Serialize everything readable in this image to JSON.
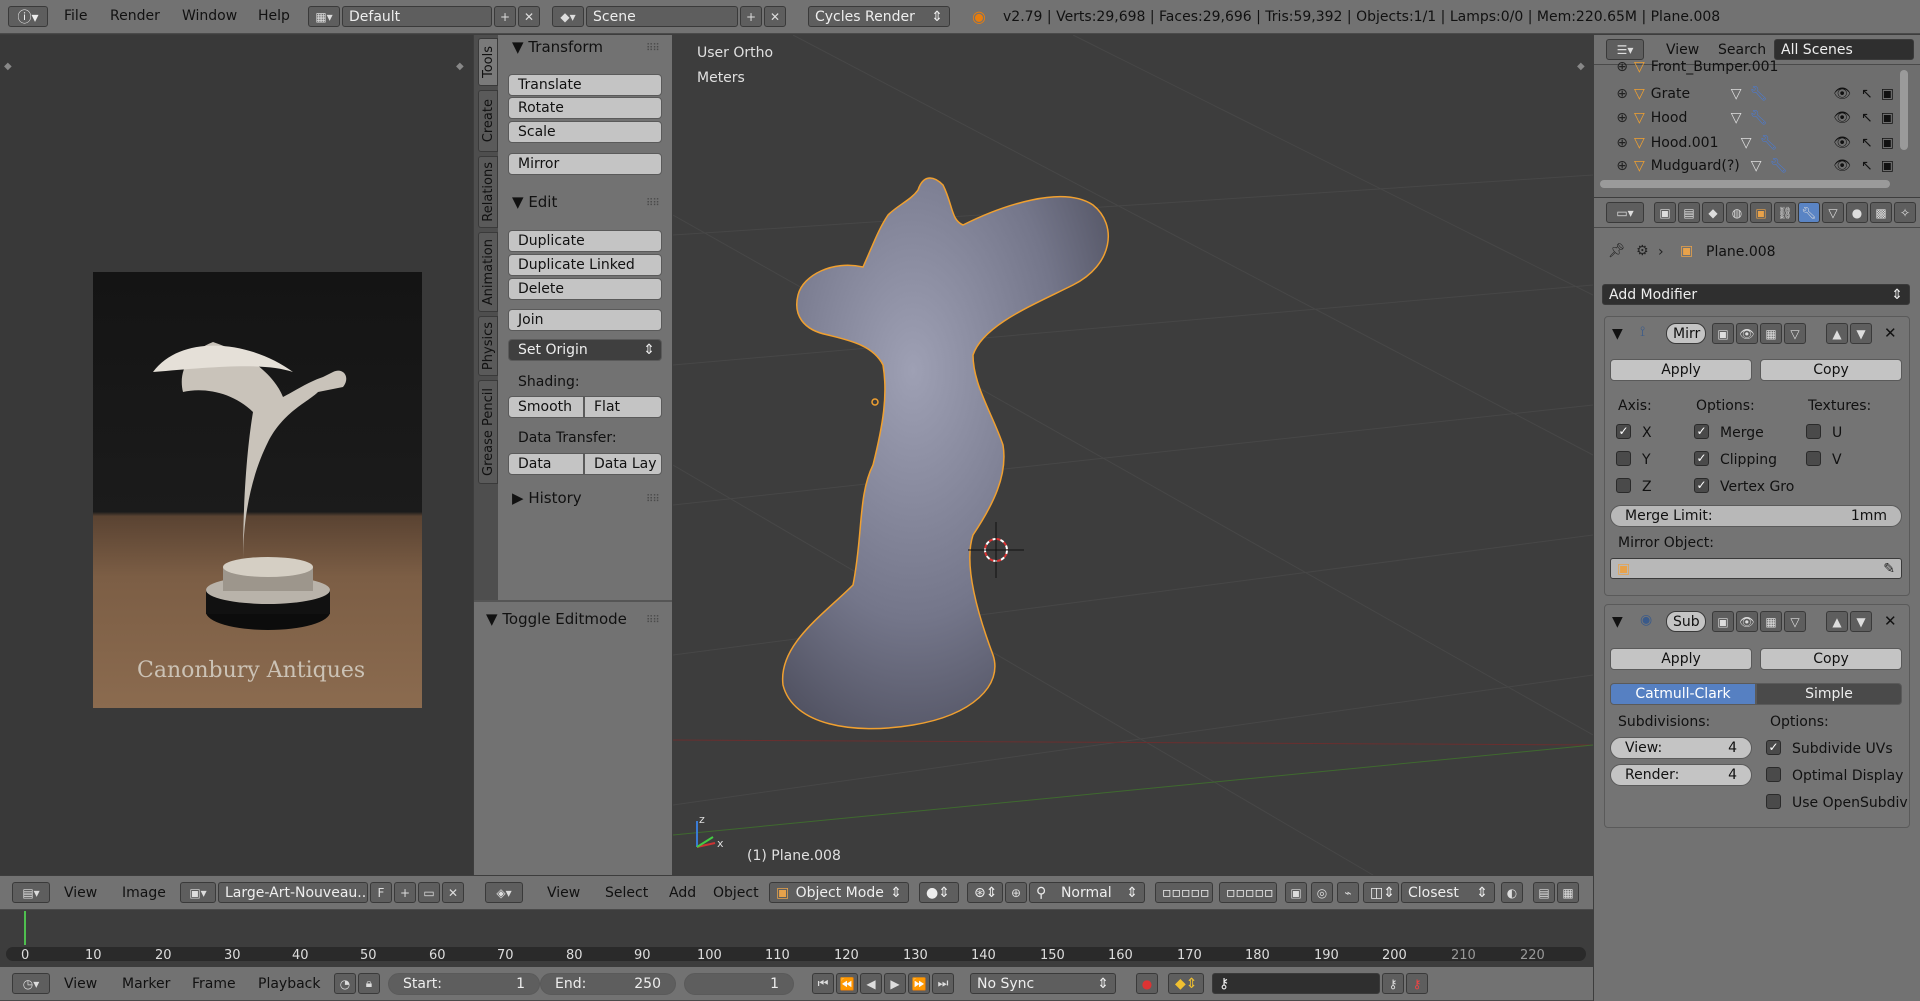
{
  "top_bar": {
    "menus": [
      "File",
      "Render",
      "Window",
      "Help"
    ],
    "layout": "Default",
    "scene": "Scene",
    "engine": "Cycles Render",
    "stats": "v2.79 | Verts:29,698 | Faces:29,696 | Tris:59,392 | Objects:1/1 | Lamps:0/0 | Mem:220.65M | Plane.008"
  },
  "image_editor": {
    "watermark": "Canonbury Antiques",
    "menus": [
      "View",
      "Image"
    ],
    "image_name": "Large-Art-Nouveau...",
    "f_label": "F"
  },
  "tool_shelf": {
    "tabs": [
      "Tools",
      "Create",
      "Relations",
      "Animation",
      "Physics",
      "Grease Pencil"
    ],
    "transform": {
      "title": "Transform",
      "buttons": [
        "Translate",
        "Rotate",
        "Scale",
        "Mirror"
      ]
    },
    "edit": {
      "title": "Edit",
      "buttons": [
        "Duplicate",
        "Duplicate Linked",
        "Delete",
        "Join"
      ],
      "set_origin": "Set Origin"
    },
    "shading": {
      "label": "Shading:",
      "smooth": "Smooth",
      "flat": "Flat"
    },
    "data_transfer": {
      "label": "Data Transfer:",
      "data": "Data",
      "data_lay": "Data Lay"
    },
    "history": "History",
    "toggle_editmode": "Toggle Editmode"
  },
  "viewport": {
    "view_label": "User Ortho",
    "units_label": "Meters",
    "object_label": "(1) Plane.008",
    "menus": [
      "View",
      "Select",
      "Add",
      "Object"
    ],
    "mode": "Object Mode",
    "pivot": "Normal",
    "snap": "Closest",
    "axis_x": "x",
    "axis_z": "z"
  },
  "timeline": {
    "ticks": [
      "0",
      "10",
      "20",
      "30",
      "40",
      "50",
      "60",
      "70",
      "80",
      "90",
      "100",
      "110",
      "120",
      "130",
      "140",
      "150",
      "160",
      "170",
      "180",
      "190",
      "200",
      "210",
      "220"
    ],
    "menus": [
      "View",
      "Marker",
      "Frame",
      "Playback"
    ],
    "start_label": "Start:",
    "start_value": "1",
    "end_label": "End:",
    "end_value": "250",
    "current": "1",
    "sync": "No Sync"
  },
  "outliner": {
    "menus": [
      "View",
      "Search"
    ],
    "filter": "All Scenes",
    "items": [
      "Front_Bumper.001",
      "Grate",
      "Hood",
      "Hood.001",
      "Mudguard(?)"
    ]
  },
  "properties": {
    "object_name": "Plane.008",
    "add_modifier": "Add Modifier",
    "mirror": {
      "name": "Mirr",
      "apply": "Apply",
      "copy": "Copy",
      "axis_label": "Axis:",
      "options_label": "Options:",
      "textures_label": "Textures:",
      "axes": [
        {
          "label": "X",
          "checked": true
        },
        {
          "label": "Y",
          "checked": false
        },
        {
          "label": "Z",
          "checked": false
        }
      ],
      "options": [
        {
          "label": "Merge",
          "checked": true
        },
        {
          "label": "Clipping",
          "checked": true
        },
        {
          "label": "Vertex Gro",
          "checked": true
        }
      ],
      "textures": [
        {
          "label": "U",
          "checked": false
        },
        {
          "label": "V",
          "checked": false
        }
      ],
      "merge_limit_label": "Merge Limit:",
      "merge_limit_value": "1mm",
      "mirror_object_label": "Mirror Object:"
    },
    "subsurf": {
      "name": "Sub",
      "apply": "Apply",
      "copy": "Copy",
      "catmull": "Catmull-Clark",
      "simple": "Simple",
      "subdivisions_label": "Subdivisions:",
      "options_label": "Options:",
      "view_label": "View:",
      "view_value": "4",
      "render_label": "Render:",
      "render_value": "4",
      "options": [
        {
          "label": "Subdivide UVs",
          "checked": true
        },
        {
          "label": "Optimal Display",
          "checked": false
        },
        {
          "label": "Use OpenSubdiv",
          "checked": false
        }
      ]
    }
  }
}
